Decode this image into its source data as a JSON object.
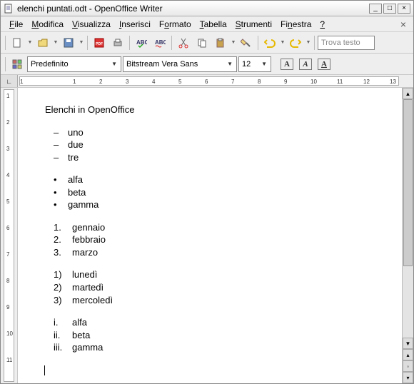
{
  "window": {
    "title": "elenchi puntati.odt - OpenOffice Writer"
  },
  "menu": {
    "file": "File",
    "modifica": "Modifica",
    "visualizza": "Visualizza",
    "inserisci": "Inserisci",
    "formato": "Formato",
    "tabella": "Tabella",
    "strumenti": "Strumenti",
    "finestra": "Finestra",
    "help": "?"
  },
  "toolbar": {
    "find_placeholder": "Trova testo"
  },
  "format_bar": {
    "style": "Predefinito",
    "font": "Bitstream Vera Sans",
    "size": "12"
  },
  "ruler_h": [
    "1",
    "",
    "1",
    "2",
    "3",
    "4",
    "5",
    "6",
    "7",
    "8",
    "9",
    "10",
    "11",
    "12",
    "13"
  ],
  "ruler_v": [
    "1",
    "2",
    "3",
    "4",
    "5",
    "6",
    "7",
    "8",
    "9",
    "10",
    "11"
  ],
  "document": {
    "title": "Elenchi in OpenOffice",
    "lists": [
      {
        "marker_type": "dash",
        "items": [
          "uno",
          "due",
          "tre"
        ]
      },
      {
        "marker_type": "bullet",
        "items": [
          "alfa",
          "beta",
          "gamma"
        ]
      },
      {
        "marker_type": "num_dot",
        "items": [
          "gennaio",
          "febbraio",
          "marzo"
        ]
      },
      {
        "marker_type": "num_paren",
        "items": [
          "lunedì",
          "martedì",
          "mercoledì"
        ]
      },
      {
        "marker_type": "roman",
        "items": [
          "alfa",
          "beta",
          "gamma"
        ]
      }
    ]
  }
}
